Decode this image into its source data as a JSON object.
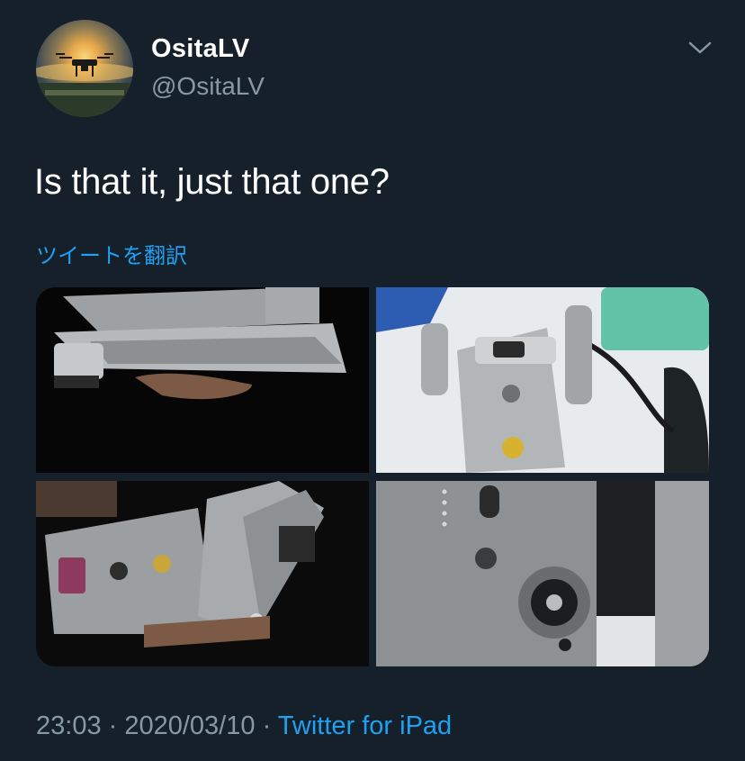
{
  "tweet": {
    "display_name": "OsitaLV",
    "handle": "@OsitaLV",
    "text": "Is that it, just that one?",
    "translate_label": "ツイートを翻訳",
    "time": "23:03",
    "separator1": " · ",
    "date": "2020/03/10",
    "separator2": " · ",
    "source": "Twitter for iPad"
  },
  "icons": {
    "menu": "chevron-down-icon"
  },
  "colors": {
    "background": "#15202b",
    "text": "#ffffff",
    "secondary": "#8899a6",
    "link": "#1da1f2"
  }
}
